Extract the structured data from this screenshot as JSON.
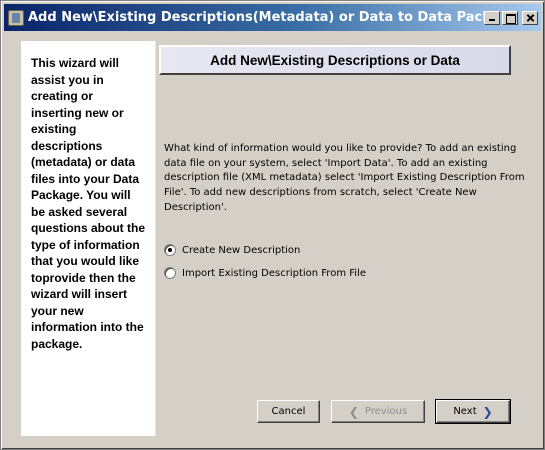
{
  "window": {
    "title": "Add New\\Existing Descriptions(Metadata) or Data to Data Package"
  },
  "sidebar": {
    "text": "This wizard will assist you in creating or inserting new or existing descriptions (metadata) or data files into your Data Package. You will be asked several questions about the type of information that you would like toprovide then the wizard will insert your new information into the package."
  },
  "main": {
    "header_title": "Add New\\Existing Descriptions or Data",
    "description": "What kind of information would you like to provide? To add an existing data file on your system, select 'Import Data'. To add an existing description file (XML metadata) select 'Import Existing Description From File'. To add new descriptions from scratch, select 'Create New Description'.",
    "options": [
      {
        "label": "Create New Description",
        "selected": true
      },
      {
        "label": "Import Existing Description From File",
        "selected": false
      }
    ]
  },
  "buttons": {
    "cancel": "Cancel",
    "previous": "Previous",
    "next": "Next",
    "previous_icon": "chevron-left-icon",
    "next_icon": "chevron-right-icon"
  }
}
